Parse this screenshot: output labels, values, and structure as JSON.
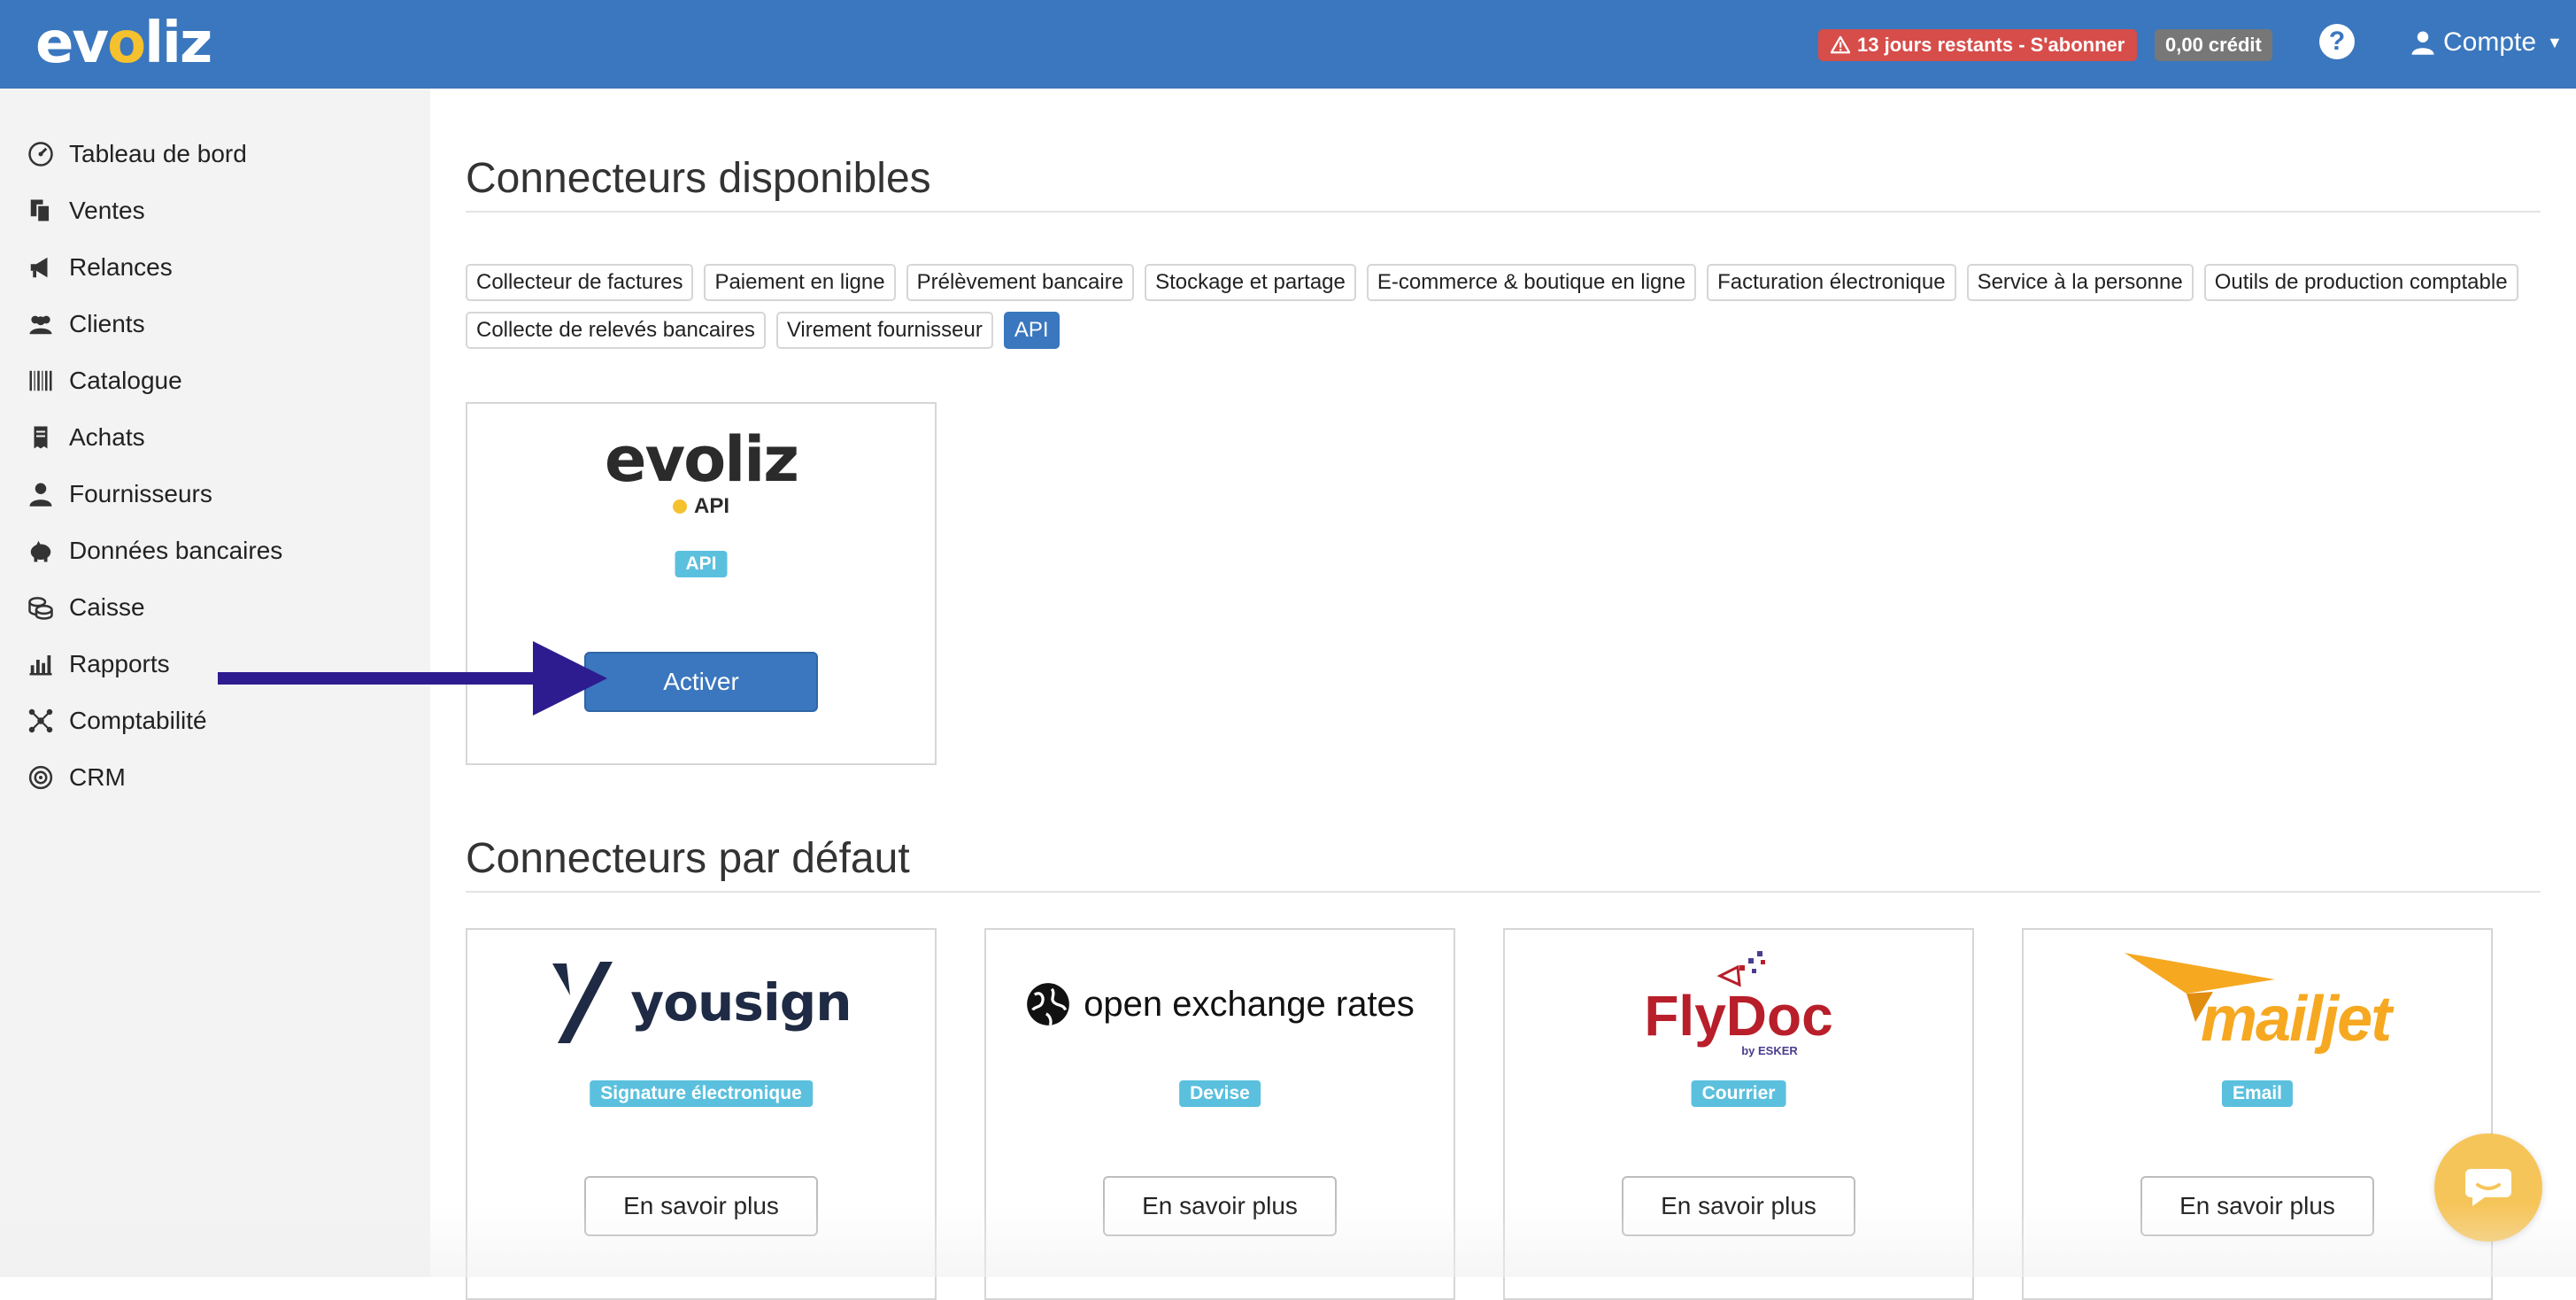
{
  "header": {
    "logo_text_pre": "ev",
    "logo_text_mid": "o",
    "logo_text_post": "liz",
    "trial_badge": "13 jours restants - S'abonner",
    "credit_badge": "0,00 crédit",
    "help_label": "?",
    "account_label": "Compte",
    "colors": {
      "bar": "#3a77be",
      "trial": "#d64d4a",
      "credit": "#777777"
    }
  },
  "sidebar": {
    "items": [
      {
        "label": "Tableau de bord",
        "icon": "dashboard-icon"
      },
      {
        "label": "Ventes",
        "icon": "documents-icon"
      },
      {
        "label": "Relances",
        "icon": "megaphone-icon"
      },
      {
        "label": "Clients",
        "icon": "users-icon"
      },
      {
        "label": "Catalogue",
        "icon": "barcode-icon"
      },
      {
        "label": "Achats",
        "icon": "receipt-icon"
      },
      {
        "label": "Fournisseurs",
        "icon": "user-icon"
      },
      {
        "label": "Données bancaires",
        "icon": "piggy-bank-icon"
      },
      {
        "label": "Caisse",
        "icon": "coins-icon"
      },
      {
        "label": "Rapports",
        "icon": "bar-chart-icon"
      },
      {
        "label": "Comptabilité",
        "icon": "network-icon"
      },
      {
        "label": "CRM",
        "icon": "crm-icon"
      }
    ]
  },
  "available": {
    "title": "Connecteurs disponibles",
    "filters_row1": [
      "Collecteur de factures",
      "Paiement en ligne",
      "Prélèvement bancaire",
      "Stockage et partage",
      "E-commerce & boutique en ligne",
      "Facturation électronique",
      "Service à la personne",
      "Outils de production comptable"
    ],
    "filters_row2": [
      "Collecte de relevés bancaires",
      "Virement fournisseur",
      "API"
    ],
    "active_filter": "API",
    "api_card": {
      "logo_main": "evoliz",
      "logo_sub": "API",
      "tag": "API",
      "button": "Activer"
    }
  },
  "defaults": {
    "title": "Connecteurs par défaut",
    "cards": [
      {
        "logo": "yousign",
        "tag": "Signature électronique",
        "button": "En savoir plus"
      },
      {
        "logo": "open exchange rates",
        "tag": "Devise",
        "button": "En savoir plus"
      },
      {
        "logo": "FlyDoc",
        "logo_sub": "by ESKER",
        "tag": "Courrier",
        "button": "En savoir plus"
      },
      {
        "logo": "mailjet",
        "tag": "Email",
        "button": "En savoir plus"
      }
    ]
  }
}
